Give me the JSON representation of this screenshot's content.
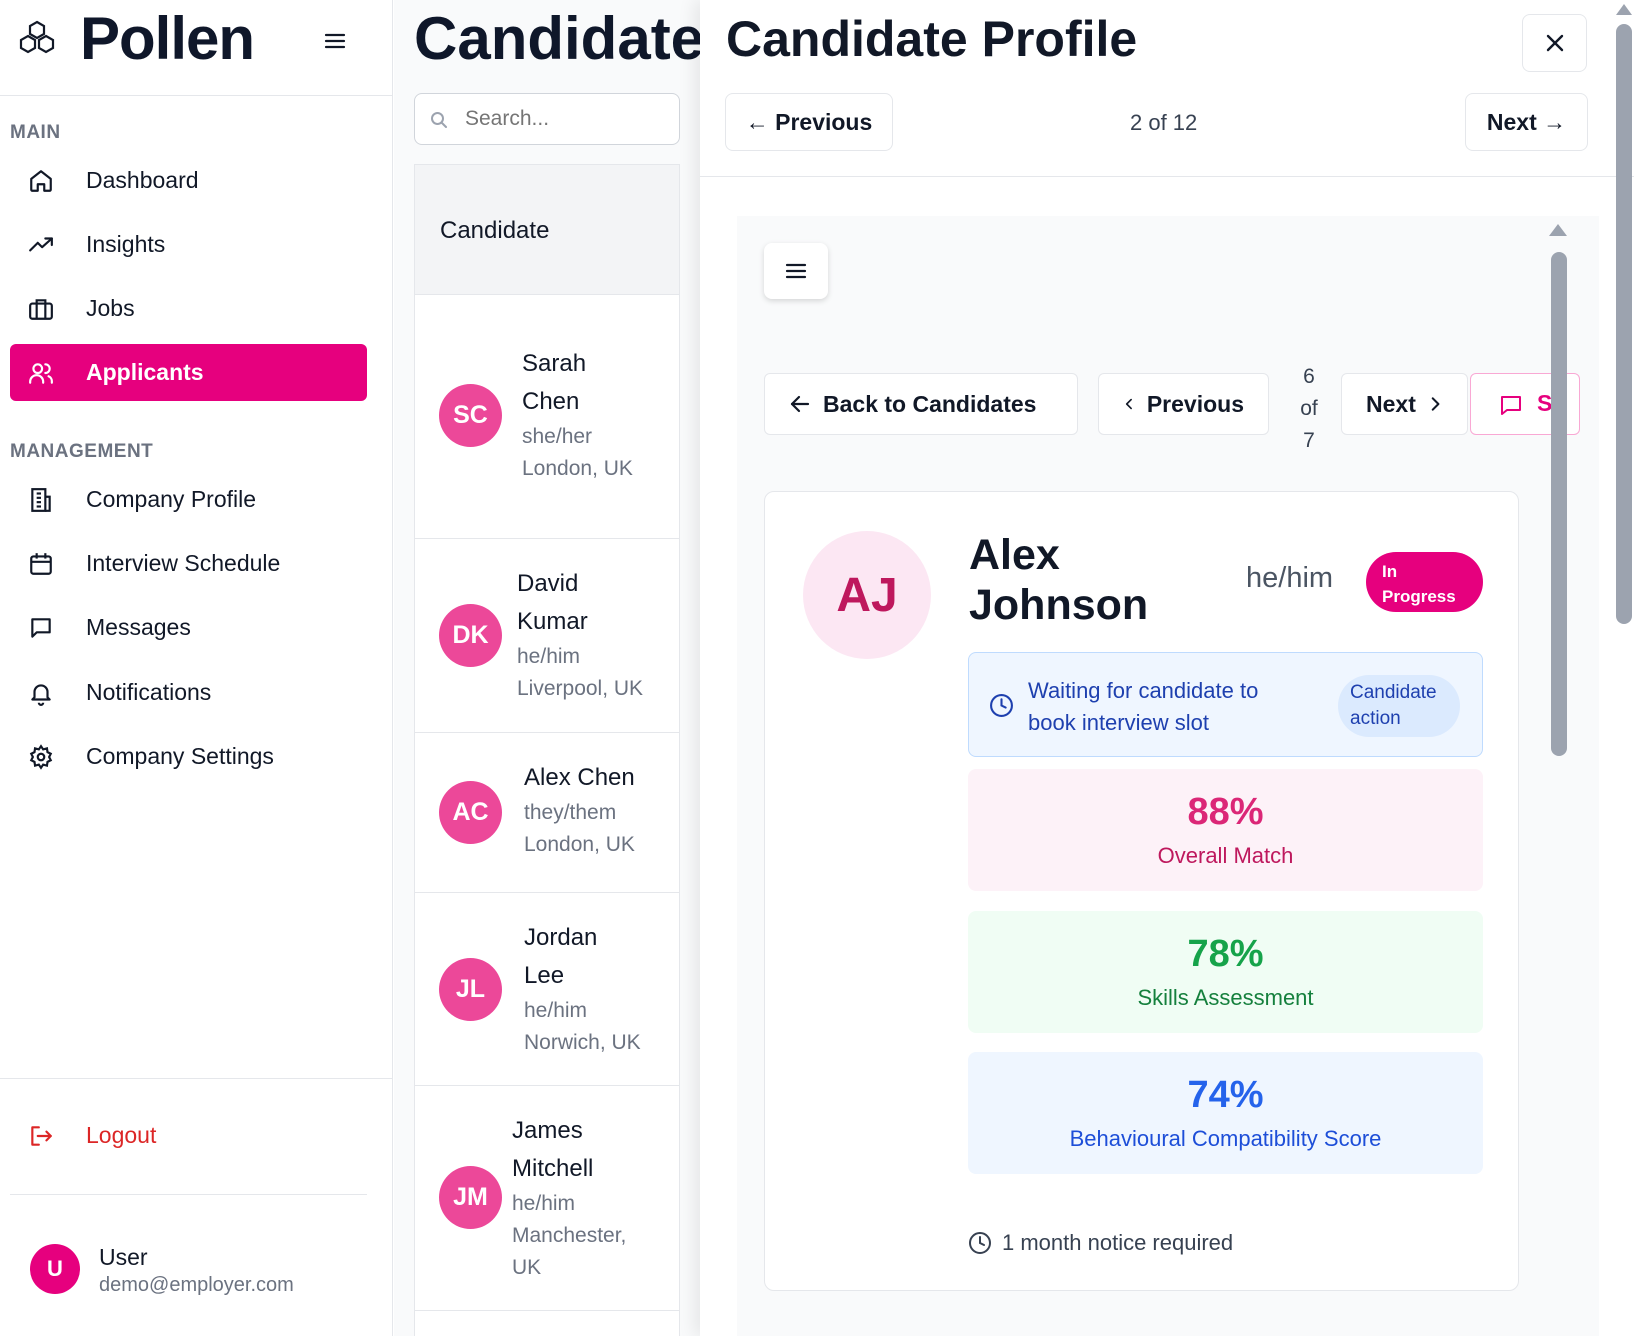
{
  "app": {
    "name": "Pollen"
  },
  "sidebar": {
    "main_label": "MAIN",
    "management_label": "MANAGEMENT",
    "main_items": [
      {
        "label": "Dashboard",
        "icon": "home-icon"
      },
      {
        "label": "Insights",
        "icon": "trending-up-icon"
      },
      {
        "label": "Jobs",
        "icon": "briefcase-icon"
      },
      {
        "label": "Applicants",
        "icon": "users-icon",
        "active": true
      }
    ],
    "management_items": [
      {
        "label": "Company Profile",
        "icon": "building-icon"
      },
      {
        "label": "Interview Schedule",
        "icon": "calendar-icon"
      },
      {
        "label": "Messages",
        "icon": "message-icon"
      },
      {
        "label": "Notifications",
        "icon": "bell-icon"
      },
      {
        "label": "Company Settings",
        "icon": "gear-icon"
      }
    ],
    "logout_label": "Logout",
    "user": {
      "initial": "U",
      "name": "User",
      "email": "demo@employer.com"
    }
  },
  "candidates_list": {
    "title": "Candidates",
    "search_placeholder": "Search...",
    "column_header": "Candidate",
    "rows": [
      {
        "initials": "SC",
        "name_lines": [
          "Sarah",
          "Chen"
        ],
        "pronouns": "she/her",
        "location_lines": [
          "London, UK"
        ]
      },
      {
        "initials": "DK",
        "name_lines": [
          "David",
          "Kumar"
        ],
        "pronouns": "he/him",
        "location_lines": [
          "Liverpool, UK"
        ]
      },
      {
        "initials": "AC",
        "name_lines": [
          "Alex Chen"
        ],
        "pronouns": "they/them",
        "location_lines": [
          "London, UK"
        ]
      },
      {
        "initials": "JL",
        "name_lines": [
          "Jordan",
          "Lee"
        ],
        "pronouns": "he/him",
        "location_lines": [
          "Norwich, UK"
        ]
      },
      {
        "initials": "JM",
        "name_lines": [
          "James",
          "Mitchell"
        ],
        "pronouns": "he/him",
        "location_lines": [
          "Manchester,",
          "UK"
        ]
      }
    ]
  },
  "profile_panel": {
    "title": "Candidate Profile",
    "previous_label": "← Previous",
    "next_label": "Next →",
    "counter": "2 of 12",
    "close_icon": "close-icon"
  },
  "detail": {
    "back_label": "Back to Candidates",
    "previous_label": "Previous",
    "next_label": "Next",
    "counter_lines": [
      "6",
      "of",
      "7"
    ],
    "share_label": "S",
    "candidate": {
      "initials": "AJ",
      "name_lines": [
        "Alex",
        "Johnson"
      ],
      "pronouns": "he/him",
      "status_lines": [
        "In",
        "Progress"
      ],
      "waiting_lines": [
        "Waiting for candidate to",
        "book interview slot"
      ],
      "action_lines": [
        "Candidate",
        "action"
      ],
      "scores": [
        {
          "value": "88%",
          "label": "Overall Match",
          "color": "#db2777",
          "bg": "#fdf2f8",
          "label_color": "#be185d"
        },
        {
          "value": "78%",
          "label": "Skills Assessment",
          "color": "#16a34a",
          "bg": "#f0fdf4",
          "label_color": "#15803d"
        },
        {
          "value": "74%",
          "label": "Behavioural Compatibility Score",
          "color": "#2563eb",
          "bg": "#eff6ff",
          "label_color": "#1d4ed8"
        }
      ],
      "notice": "1 month notice required"
    }
  },
  "colors": {
    "brand": "#e6007e",
    "avatar": "#ec4899",
    "logout": "#dc2626"
  }
}
